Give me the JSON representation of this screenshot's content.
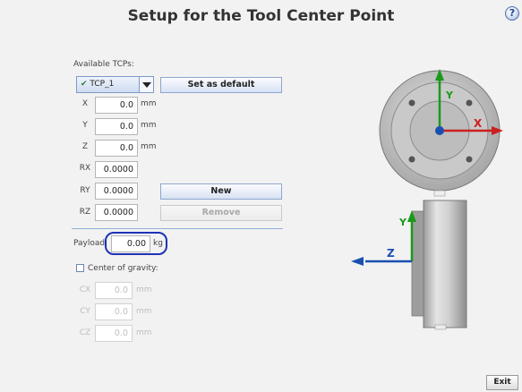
{
  "header": {
    "title": "Setup for the Tool Center Point",
    "help_label": "?"
  },
  "tcp": {
    "available_label": "Available TCPs:",
    "selected": "TCP_1",
    "set_default_label": "Set as default",
    "new_label": "New",
    "remove_label": "Remove"
  },
  "position": [
    {
      "label": "X",
      "value": "0.0",
      "unit": "mm"
    },
    {
      "label": "Y",
      "value": "0.0",
      "unit": "mm"
    },
    {
      "label": "Z",
      "value": "0.0",
      "unit": "mm"
    }
  ],
  "rotation": [
    {
      "label": "RX",
      "value": "0.0000"
    },
    {
      "label": "RY",
      "value": "0.0000"
    },
    {
      "label": "RZ",
      "value": "0.0000"
    }
  ],
  "payload": {
    "label": "Payload:",
    "value": "0.00",
    "unit": "kg"
  },
  "center_of_gravity": {
    "label": "Center of gravity:",
    "checked": false,
    "fields": [
      {
        "label": "CX",
        "value": "0.0",
        "unit": "mm"
      },
      {
        "label": "CY",
        "value": "0.0",
        "unit": "mm"
      },
      {
        "label": "CZ",
        "value": "0.0",
        "unit": "mm"
      }
    ]
  },
  "diagram": {
    "front_x": "X",
    "front_y": "Y",
    "side_y": "Y",
    "side_z": "Z"
  },
  "footer": {
    "exit_label": "Exit"
  },
  "colors": {
    "x_axis": "#cc1f1f",
    "y_axis": "#1a9a1a",
    "z_axis": "#1a4fb0",
    "highlight": "#1d33b5"
  }
}
